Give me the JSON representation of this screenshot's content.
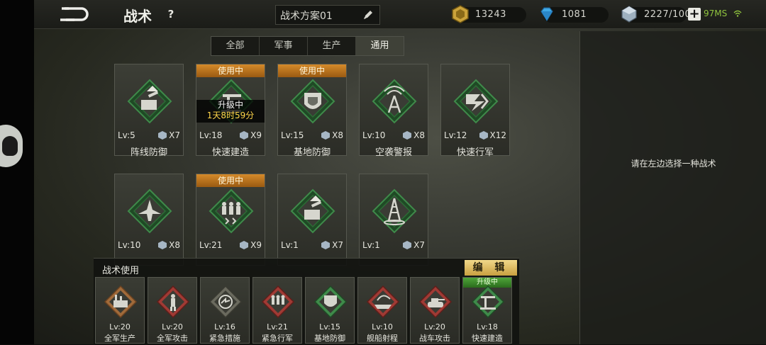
{
  "header": {
    "title": "战术",
    "help_label": "?",
    "plan_name": "战术方案01",
    "resources": [
      {
        "icon": "gold-coin-icon",
        "value": "13243"
      },
      {
        "icon": "diamond-icon",
        "value": "1081"
      },
      {
        "icon": "crystal-icon",
        "value": "2227/100"
      }
    ],
    "add_label": "+",
    "ping": "97MS"
  },
  "tabs": [
    {
      "label": "全部",
      "active": false
    },
    {
      "label": "军事",
      "active": false
    },
    {
      "label": "生产",
      "active": false
    },
    {
      "label": "通用",
      "active": true
    }
  ],
  "tactics": [
    {
      "name": "阵线防御",
      "level": "Lv:5",
      "count": "X7",
      "icon": "turret-icon",
      "status": ""
    },
    {
      "name": "快速建造",
      "level": "Lv:18",
      "count": "X9",
      "icon": "construction-crane-icon",
      "status": "使用中",
      "upgrade_label": "升级中",
      "upgrade_time": "1天8时59分"
    },
    {
      "name": "基地防御",
      "level": "Lv:15",
      "count": "X8",
      "icon": "base-shield-icon",
      "status": "使用中"
    },
    {
      "name": "空袭警报",
      "level": "Lv:10",
      "count": "X8",
      "icon": "radar-tower-icon",
      "status": ""
    },
    {
      "name": "快速行军",
      "level": "Lv:12",
      "count": "X12",
      "icon": "speed-arrow-icon",
      "status": ""
    },
    {
      "name": "",
      "level": "Lv:10",
      "count": "X8",
      "icon": "aircraft-icon",
      "status": ""
    },
    {
      "name": "",
      "level": "Lv:21",
      "count": "X9",
      "icon": "marching-troops-icon",
      "status": "使用中"
    },
    {
      "name": "",
      "level": "Lv:1",
      "count": "X7",
      "icon": "turret-icon",
      "status": ""
    },
    {
      "name": "",
      "level": "Lv:1",
      "count": "X7",
      "icon": "tower-icon",
      "status": ""
    }
  ],
  "right_panel": {
    "hint": "请在左边选择一种战术"
  },
  "usage": {
    "title": "战术使用",
    "edit_label": "编 辑",
    "slots": [
      {
        "name": "全军生产",
        "level": "Lv:20",
        "icon": "factory-icon",
        "accent": "#a06a3a"
      },
      {
        "name": "全军攻击",
        "level": "Lv:20",
        "icon": "soldier-icon",
        "accent": "#a03a34"
      },
      {
        "name": "紧急措施",
        "level": "Lv:16",
        "icon": "emergency-icon",
        "accent": "#6a6a5e"
      },
      {
        "name": "紧急行军",
        "level": "Lv:21",
        "icon": "marching-troops-icon",
        "accent": "#a03a34"
      },
      {
        "name": "基地防御",
        "level": "Lv:15",
        "icon": "base-shield-icon",
        "accent": "#3f8a4a"
      },
      {
        "name": "舰船射程",
        "level": "Lv:10",
        "icon": "ship-icon",
        "accent": "#a03a34"
      },
      {
        "name": "战车攻击",
        "level": "Lv:20",
        "icon": "tank-icon",
        "accent": "#a03a34"
      },
      {
        "name": "快速建造",
        "level": "Lv:18",
        "icon": "construction-crane-icon",
        "accent": "#3f8a4a",
        "badge": "升级中"
      }
    ]
  },
  "colors": {
    "in_use": "#c27a22",
    "upgrade_time": "#ffd64a",
    "emblem_green": "#2f7a3a",
    "upgrade_badge": "#3f8f2e",
    "ping": "#8fc43e"
  }
}
